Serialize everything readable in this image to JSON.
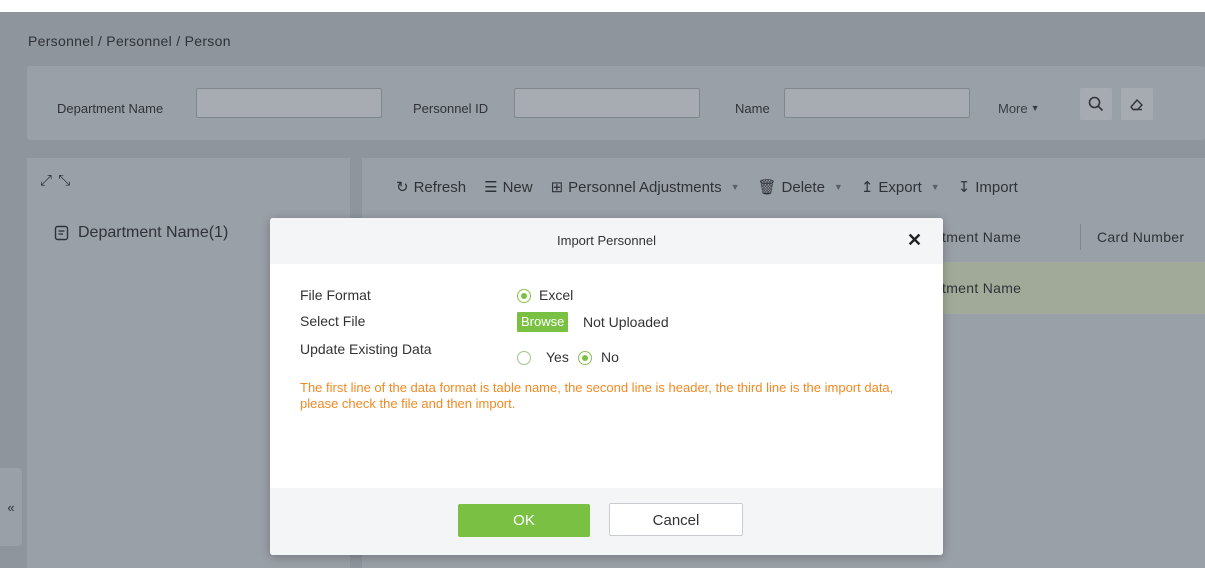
{
  "breadcrumb": "Personnel / Personnel / Person",
  "search": {
    "department_label": "Department Name",
    "department_value": "",
    "personnel_id_label": "Personnel ID",
    "personnel_id_value": "",
    "name_label": "Name",
    "name_value": "",
    "more_label": "More",
    "search_icon": "search-icon",
    "clear_icon": "eraser-icon"
  },
  "tree": {
    "expand_icons": "expand-collapse-icons",
    "item_label": "Department Name(1)"
  },
  "toolbar": {
    "refresh": "Refresh",
    "new": "New",
    "adjustments": "Personnel Adjustments",
    "delete": "Delete",
    "export": "Export",
    "import": "Import"
  },
  "grid": {
    "header_dept": "tment Name",
    "header_card": "Card Number",
    "row_dept": "tment Name"
  },
  "sidebar_toggle": "«",
  "dialog": {
    "title": "Import Personnel",
    "file_format_label": "File Format",
    "file_format_option": "Excel",
    "select_file_label": "Select File",
    "browse_label": "Browse",
    "file_status": "Not Uploaded",
    "update_label": "Update Existing Data",
    "yes_label": "Yes",
    "no_label": "No",
    "selected_update_option": "No",
    "hint": "The first line of the data format is table name, the second line is header, the third line is the import data, please check the file and then import.",
    "ok_label": "OK",
    "cancel_label": "Cancel"
  },
  "colors": {
    "accent_green": "#7ac143",
    "hint_orange": "#f08a24"
  }
}
